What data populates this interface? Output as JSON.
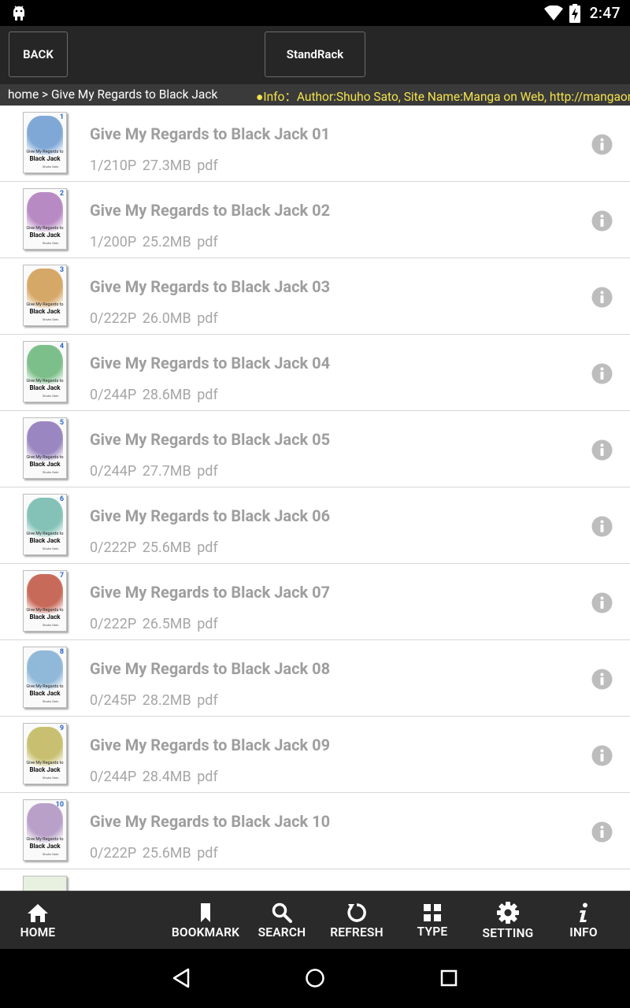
{
  "status_bar": {
    "time": "2:47"
  },
  "top_bar": {
    "back_label": "BACK",
    "rack_label": "StandRack"
  },
  "breadcrumb": {
    "path": "home > Give My Regards to Black Jack",
    "info": "●Info：Author:Shuho Sato, Site Name:Manga on Web, http://mangaonweb.com"
  },
  "books": [
    {
      "title": "Give My Regards to Black Jack 01",
      "meta": "1/210P  27.3MB  pdf",
      "cover_num": "1",
      "cover_color": "#7fa8d6"
    },
    {
      "title": "Give My Regards to Black Jack 02",
      "meta": "1/200P  25.2MB  pdf",
      "cover_num": "2",
      "cover_color": "#b88ac4"
    },
    {
      "title": "Give My Regards to Black Jack 03",
      "meta": "0/222P  26.0MB  pdf",
      "cover_num": "3",
      "cover_color": "#d6a868"
    },
    {
      "title": "Give My Regards to Black Jack 04",
      "meta": "0/244P  28.6MB  pdf",
      "cover_num": "4",
      "cover_color": "#7cbf8a"
    },
    {
      "title": "Give My Regards to Black Jack 05",
      "meta": "0/244P  27.7MB  pdf",
      "cover_num": "5",
      "cover_color": "#9a86c0"
    },
    {
      "title": "Give My Regards to Black Jack 06",
      "meta": "0/222P  25.6MB  pdf",
      "cover_num": "6",
      "cover_color": "#84c2b8"
    },
    {
      "title": "Give My Regards to Black Jack 07",
      "meta": "0/222P  26.5MB  pdf",
      "cover_num": "7",
      "cover_color": "#c86a5a"
    },
    {
      "title": "Give My Regards to Black Jack 08",
      "meta": "0/245P  28.2MB  pdf",
      "cover_num": "8",
      "cover_color": "#90b8d8"
    },
    {
      "title": "Give My Regards to Black Jack 09",
      "meta": "0/244P  28.4MB  pdf",
      "cover_num": "9",
      "cover_color": "#c8c070"
    },
    {
      "title": "Give My Regards to Black Jack 10",
      "meta": "0/222P  25.6MB  pdf",
      "cover_num": "10",
      "cover_color": "#b8a0c8"
    }
  ],
  "cover_text": {
    "line1": "Give My Regards to",
    "line2": "Black Jack",
    "line3": "Shuho Sato"
  },
  "bottom_nav": {
    "home": "HOME",
    "bookmark": "BOOKMARK",
    "search": "SEARCH",
    "refresh": "REFRESH",
    "type": "TYPE",
    "setting": "SETTING",
    "info": "INFO"
  },
  "colors": {
    "info_text": "#f3e24b",
    "bar_bg": "#262626",
    "title_gray": "#9e9e9e"
  }
}
